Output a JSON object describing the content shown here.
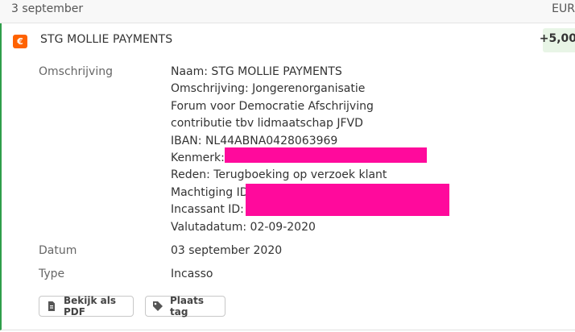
{
  "header": {
    "date": "3 september",
    "currency": "EUR"
  },
  "transaction": {
    "name": "STG MOLLIE PAYMENTS",
    "amount": "+5,00",
    "icon_symbol": "€",
    "colors": {
      "accent_orange": "#ff6200",
      "positive_green": "#2f9e4a",
      "amount_bg": "#e8f5e6",
      "redaction": "#ff0a9c"
    },
    "details": {
      "omschrijving_label": "Omschrijving",
      "lines": [
        "Naam: STG MOLLIE PAYMENTS",
        "Omschrijving: Jongerenorganisatie",
        "Forum voor Democratie Afschrijving",
        "contributie tbv lidmaatschap JFVD",
        "IBAN: NL44ABNA0428063969",
        "Kenmerk: S",
        "Reden: Terugboeking op verzoek klant",
        "Machtiging ID:",
        "Incassant ID: N",
        "Valutadatum: 02-09-2020"
      ],
      "datum_label": "Datum",
      "datum_value": "03 september 2020",
      "type_label": "Type",
      "type_value": "Incasso"
    },
    "actions": {
      "pdf_label": "Bekijk als PDF",
      "pdf_icon": "document-icon",
      "tag_label": "Plaats tag",
      "tag_icon": "tag-icon"
    }
  }
}
